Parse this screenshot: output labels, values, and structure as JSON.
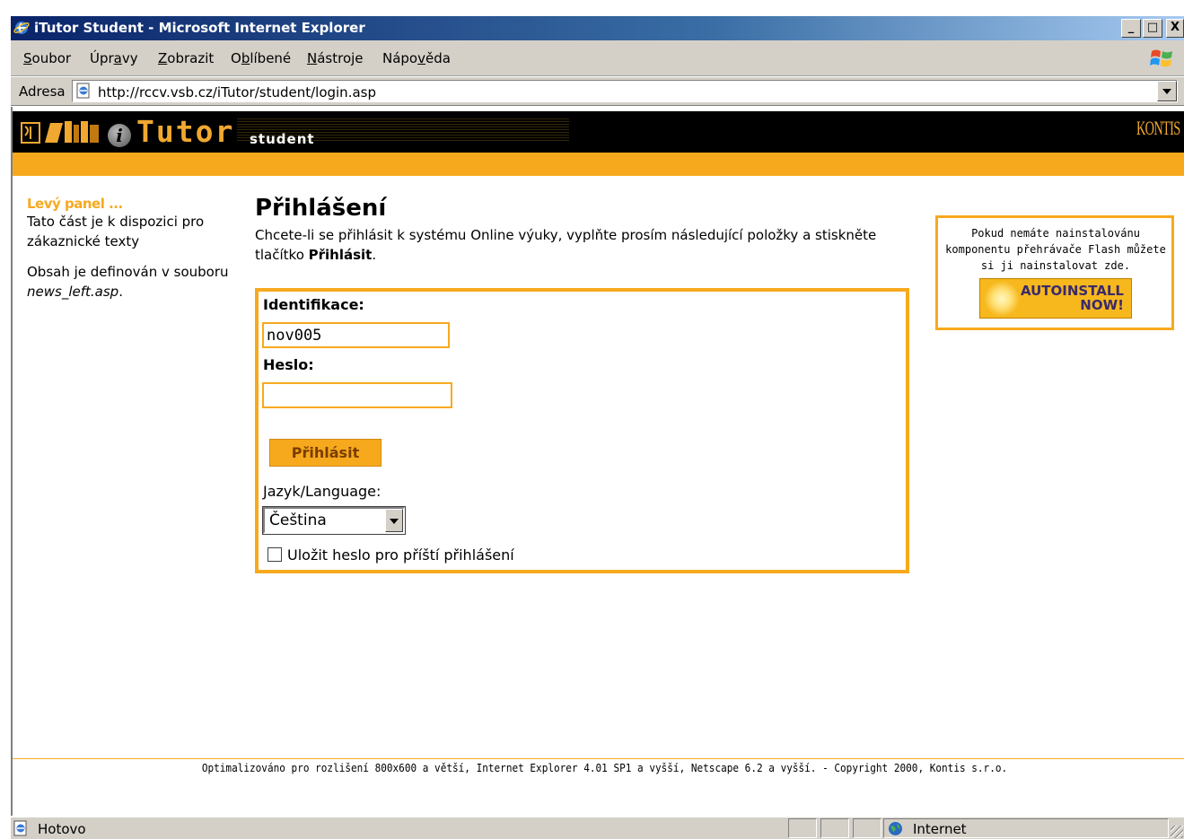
{
  "window": {
    "title": "iTutor Student - Microsoft Internet Explorer",
    "min_label": "_",
    "max_label": "□",
    "close_label": "X"
  },
  "menubar": {
    "items": [
      {
        "accel": "S",
        "rest": "oubor"
      },
      {
        "pre": "Úpr",
        "accel": "a",
        "rest": "vy"
      },
      {
        "accel": "Z",
        "rest": "obrazit"
      },
      {
        "pre": "O",
        "accel": "b",
        "rest": "líbené"
      },
      {
        "accel": "N",
        "rest": "ástroje"
      },
      {
        "pre": "Nápo",
        "accel": "v",
        "rest": "ěda"
      }
    ]
  },
  "address": {
    "label": "Adresa",
    "url": "http://rccv.vsb.cz/iTutor/student/login.asp"
  },
  "banner": {
    "brand_i": "i",
    "brand": "Tutor",
    "brand_sub": "student",
    "partner": "KONTIS"
  },
  "left_panel": {
    "title": "Levý panel ...",
    "text1": "Tato část je k dispozici pro zákaznické texty",
    "text2_prefix": "Obsah je definován v souboru ",
    "text2_file": "news_left.asp",
    "text2_suffix": "."
  },
  "main": {
    "title": "Přihlášení",
    "intro_prefix": "Chcete-li se přihlásit k systému Online výuky, vyplňte prosím následující položky a stiskněte tlačítko ",
    "intro_bold": "Přihlásit",
    "intro_suffix": "."
  },
  "login": {
    "id_label": "Identifikace:",
    "id_value": "nov005",
    "pw_label": "Heslo:",
    "pw_value": "",
    "submit_label": "Přihlásit",
    "lang_label": "Jazyk/Language:",
    "lang_selected": "Čeština",
    "remember_label": "Uložit heslo pro příští přihlášení",
    "remember_checked": false
  },
  "flash": {
    "text": "Pokud nemáte nainstalovánu komponentu přehrávače Flash můžete si ji nainstalovat zde.",
    "button_line1": "AUTOINSTALL",
    "button_line2": "NOW!"
  },
  "footer": {
    "text": "Optimalizováno pro rozlišení 800x600 a větší, Internet Explorer 4.01 SP1 a vyšší, Netscape 6.2 a vyšší. - Copyright 2000, Kontis s.r.o."
  },
  "status": {
    "text": "Hotovo",
    "zone": "Internet"
  },
  "colors": {
    "accent": "#f7a91e",
    "title_bar": "#0a246a",
    "chrome": "#d4d0c8"
  }
}
